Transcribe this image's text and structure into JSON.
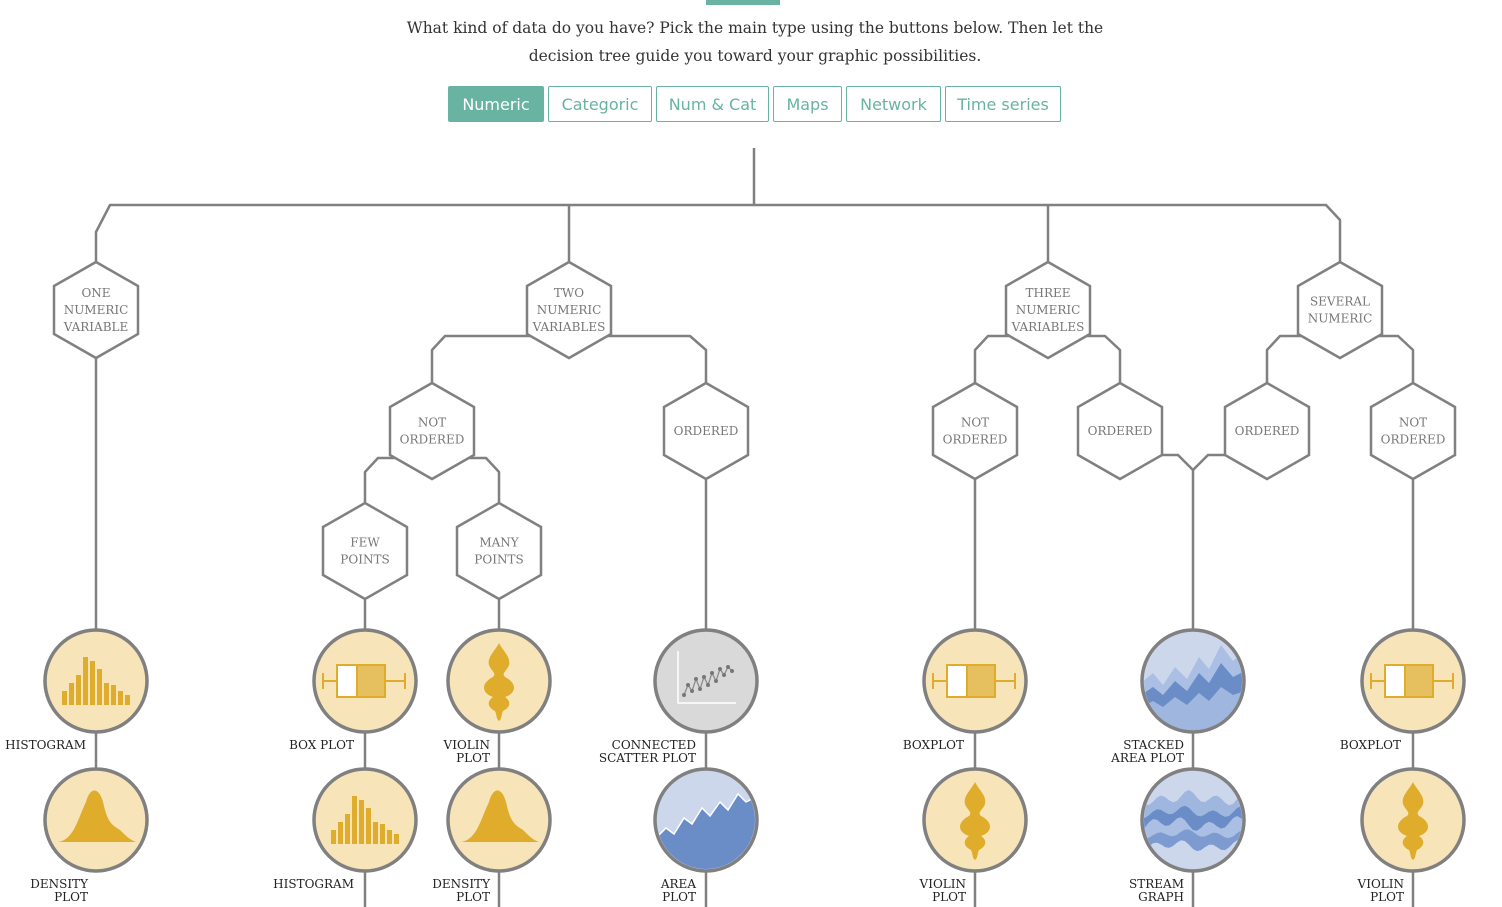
{
  "intro": {
    "line1": "What kind of data do you have? Pick the main type using the buttons below. Then let the",
    "line2": "decision tree guide you toward your graphic possibilities."
  },
  "tabs": [
    {
      "label": "Numeric",
      "active": true
    },
    {
      "label": "Categoric",
      "active": false
    },
    {
      "label": "Num & Cat",
      "active": false
    },
    {
      "label": "Maps",
      "active": false
    },
    {
      "label": "Network",
      "active": false
    },
    {
      "label": "Time series",
      "active": false
    }
  ],
  "colors": {
    "accent": "#69b3a2",
    "line": "#808080",
    "yellow_fill": "#f7e4b9",
    "yellow_icon": "#e0ac2b",
    "blue_fill": "#ccd7ec",
    "blue_icon": "#6a8dc8",
    "grey_fill": "#d9d9d9"
  },
  "nodes": {
    "one_numeric": [
      "ONE",
      "NUMERIC",
      "VARIABLE"
    ],
    "two_numeric": [
      "TWO",
      "NUMERIC",
      "VARIABLES"
    ],
    "three_numeric": [
      "THREE",
      "NUMERIC",
      "VARIABLES"
    ],
    "several_numeric": [
      "SEVERAL",
      "NUMERIC"
    ],
    "two_not_ordered": [
      "NOT",
      "ORDERED"
    ],
    "two_ordered": [
      "ORDERED"
    ],
    "few_points": [
      "FEW",
      "POINTS"
    ],
    "many_points": [
      "MANY",
      "POINTS"
    ],
    "three_not_ordered": [
      "NOT",
      "ORDERED"
    ],
    "three_ordered": [
      "ORDERED"
    ],
    "several_ordered": [
      "ORDERED"
    ],
    "several_not_ordered": [
      "NOT",
      "ORDERED"
    ]
  },
  "charts": {
    "histogram_1": {
      "label": [
        "HISTOGRAM"
      ],
      "icon": "histogram-icon"
    },
    "density_1": {
      "label": [
        "DENSITY",
        "PLOT"
      ],
      "icon": "density-icon"
    },
    "boxplot_few": {
      "label": [
        "BOX PLOT"
      ],
      "icon": "boxplot-icon"
    },
    "histogram_few": {
      "label": [
        "HISTOGRAM"
      ],
      "icon": "histogram-icon"
    },
    "violin_many": {
      "label": [
        "VIOLIN",
        "PLOT"
      ],
      "icon": "violin-icon"
    },
    "density_many": {
      "label": [
        "DENSITY",
        "PLOT"
      ],
      "icon": "density-icon"
    },
    "connected_scatter": {
      "label": [
        "CONNECTED",
        "SCATTER PLOT"
      ],
      "icon": "connected-scatter-icon"
    },
    "area_plot": {
      "label": [
        "AREA",
        "PLOT"
      ],
      "icon": "area-icon"
    },
    "boxplot_three": {
      "label": [
        "BOXPLOT"
      ],
      "icon": "boxplot-icon"
    },
    "violin_three": {
      "label": [
        "VIOLIN",
        "PLOT"
      ],
      "icon": "violin-icon"
    },
    "stacked_area": {
      "label": [
        "STACKED",
        "AREA PLOT"
      ],
      "icon": "stacked-area-icon"
    },
    "stream_graph": {
      "label": [
        "STREAM",
        "GRAPH"
      ],
      "icon": "streamgraph-icon"
    },
    "boxplot_several": {
      "label": [
        "BOXPLOT"
      ],
      "icon": "boxplot-icon"
    },
    "violin_several": {
      "label": [
        "VIOLIN",
        "PLOT"
      ],
      "icon": "violin-icon"
    }
  }
}
